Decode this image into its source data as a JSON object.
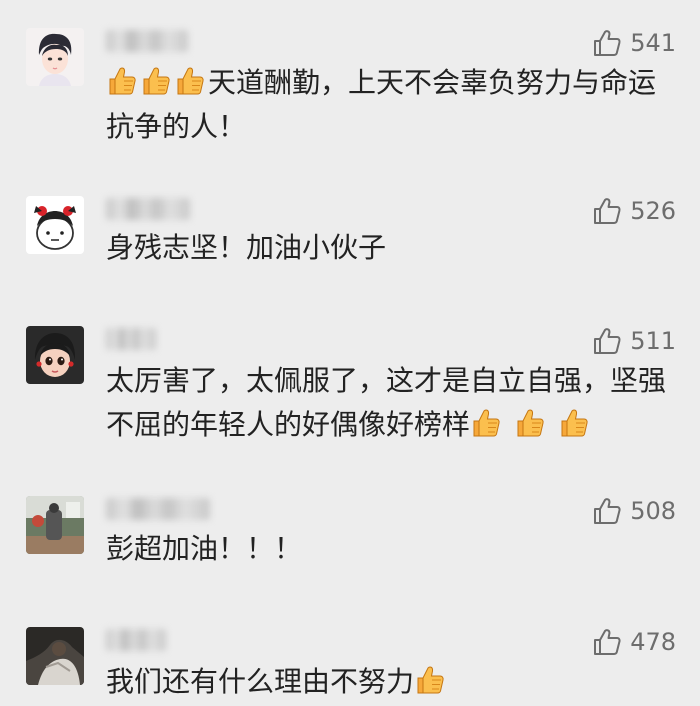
{
  "comments": [
    {
      "likes": "541",
      "text_before": "",
      "text_after": "天道酬勤，上天不会辜负努力与命运抗争的人！",
      "leading_emoji": [
        "thumbs-up-emoji",
        "thumbs-up-emoji",
        "thumbs-up-emoji"
      ],
      "trailing_emoji": []
    },
    {
      "likes": "526",
      "text_before": "身残志坚！加油小伙子",
      "text_after": "",
      "leading_emoji": [],
      "trailing_emoji": []
    },
    {
      "likes": "511",
      "text_before": "太厉害了，太佩服了，这才是自立自强，坚强不屈的年轻人的好偶像好榜样",
      "text_after": "",
      "leading_emoji": [],
      "trailing_emoji": [
        "thumbs-up-emoji",
        "thumbs-up-emoji",
        "thumbs-up-emoji"
      ]
    },
    {
      "likes": "508",
      "text_before": "彭超加油！！！",
      "text_after": "",
      "leading_emoji": [],
      "trailing_emoji": []
    },
    {
      "likes": "478",
      "text_before": "我们还有什么理由不努力",
      "text_after": "",
      "leading_emoji": [],
      "trailing_emoji": [
        "thumbs-up-emoji"
      ]
    }
  ],
  "icons": {
    "like": "thumbs-up-outline-icon",
    "emoji": "thumbs-up-emoji"
  },
  "colors": {
    "background": "#ededed",
    "text": "#222222",
    "like": "#6d6d6d",
    "emoji_skin": "#f6a83a"
  }
}
